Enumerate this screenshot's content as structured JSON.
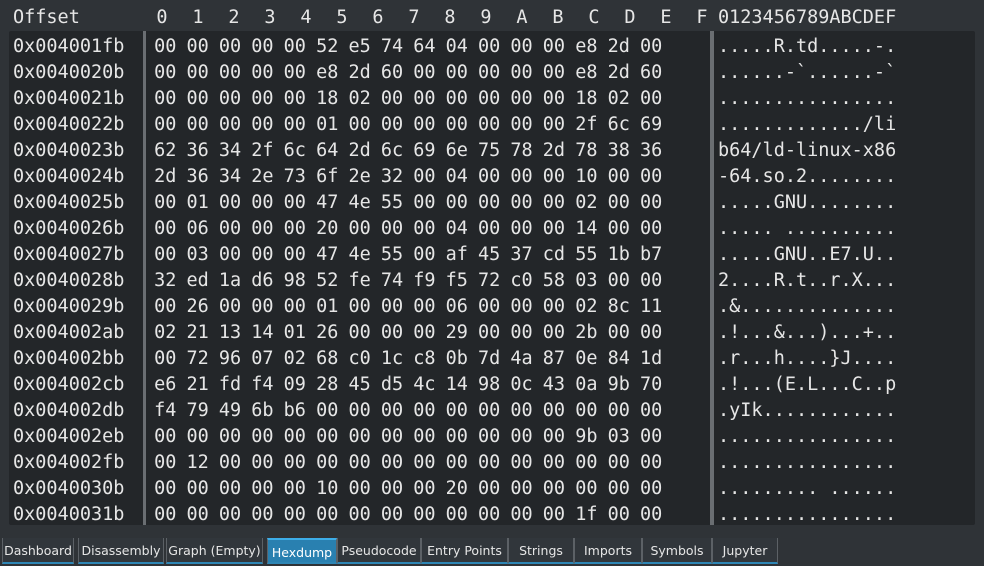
{
  "header": {
    "offset_label": "Offset",
    "columns": [
      "0",
      "1",
      "2",
      "3",
      "4",
      "5",
      "6",
      "7",
      "8",
      "9",
      "A",
      "B",
      "C",
      "D",
      "E",
      "F"
    ],
    "ascii_label": "0123456789ABCDEF"
  },
  "rows": [
    {
      "offset": "0x004001fb",
      "bytes": [
        "00",
        "00",
        "00",
        "00",
        "00",
        "52",
        "e5",
        "74",
        "64",
        "04",
        "00",
        "00",
        "00",
        "e8",
        "2d",
        "00"
      ],
      "ascii": ".....R.td.....-."
    },
    {
      "offset": "0x0040020b",
      "bytes": [
        "00",
        "00",
        "00",
        "00",
        "00",
        "e8",
        "2d",
        "60",
        "00",
        "00",
        "00",
        "00",
        "00",
        "e8",
        "2d",
        "60"
      ],
      "ascii": "......-`......-`"
    },
    {
      "offset": "0x0040021b",
      "bytes": [
        "00",
        "00",
        "00",
        "00",
        "00",
        "18",
        "02",
        "00",
        "00",
        "00",
        "00",
        "00",
        "00",
        "18",
        "02",
        "00"
      ],
      "ascii": "................"
    },
    {
      "offset": "0x0040022b",
      "bytes": [
        "00",
        "00",
        "00",
        "00",
        "00",
        "01",
        "00",
        "00",
        "00",
        "00",
        "00",
        "00",
        "00",
        "2f",
        "6c",
        "69"
      ],
      "ascii": "............./li"
    },
    {
      "offset": "0x0040023b",
      "bytes": [
        "62",
        "36",
        "34",
        "2f",
        "6c",
        "64",
        "2d",
        "6c",
        "69",
        "6e",
        "75",
        "78",
        "2d",
        "78",
        "38",
        "36"
      ],
      "ascii": "b64/ld-linux-x86"
    },
    {
      "offset": "0x0040024b",
      "bytes": [
        "2d",
        "36",
        "34",
        "2e",
        "73",
        "6f",
        "2e",
        "32",
        "00",
        "04",
        "00",
        "00",
        "00",
        "10",
        "00",
        "00"
      ],
      "ascii": "-64.so.2........"
    },
    {
      "offset": "0x0040025b",
      "bytes": [
        "00",
        "01",
        "00",
        "00",
        "00",
        "47",
        "4e",
        "55",
        "00",
        "00",
        "00",
        "00",
        "00",
        "02",
        "00",
        "00"
      ],
      "ascii": ".....GNU........"
    },
    {
      "offset": "0x0040026b",
      "bytes": [
        "00",
        "06",
        "00",
        "00",
        "00",
        "20",
        "00",
        "00",
        "00",
        "04",
        "00",
        "00",
        "00",
        "14",
        "00",
        "00"
      ],
      "ascii": "..... .........."
    },
    {
      "offset": "0x0040027b",
      "bytes": [
        "00",
        "03",
        "00",
        "00",
        "00",
        "47",
        "4e",
        "55",
        "00",
        "af",
        "45",
        "37",
        "cd",
        "55",
        "1b",
        "b7"
      ],
      "ascii": ".....GNU..E7.U.."
    },
    {
      "offset": "0x0040028b",
      "bytes": [
        "32",
        "ed",
        "1a",
        "d6",
        "98",
        "52",
        "fe",
        "74",
        "f9",
        "f5",
        "72",
        "c0",
        "58",
        "03",
        "00",
        "00"
      ],
      "ascii": "2....R.t..r.X..."
    },
    {
      "offset": "0x0040029b",
      "bytes": [
        "00",
        "26",
        "00",
        "00",
        "00",
        "01",
        "00",
        "00",
        "00",
        "06",
        "00",
        "00",
        "00",
        "02",
        "8c",
        "11"
      ],
      "ascii": ".&.............."
    },
    {
      "offset": "0x004002ab",
      "bytes": [
        "02",
        "21",
        "13",
        "14",
        "01",
        "26",
        "00",
        "00",
        "00",
        "29",
        "00",
        "00",
        "00",
        "2b",
        "00",
        "00"
      ],
      "ascii": ".!...&...)...+.."
    },
    {
      "offset": "0x004002bb",
      "bytes": [
        "00",
        "72",
        "96",
        "07",
        "02",
        "68",
        "c0",
        "1c",
        "c8",
        "0b",
        "7d",
        "4a",
        "87",
        "0e",
        "84",
        "1d"
      ],
      "ascii": ".r...h....}J...."
    },
    {
      "offset": "0x004002cb",
      "bytes": [
        "e6",
        "21",
        "fd",
        "f4",
        "09",
        "28",
        "45",
        "d5",
        "4c",
        "14",
        "98",
        "0c",
        "43",
        "0a",
        "9b",
        "70"
      ],
      "ascii": ".!...(E.L...C..p"
    },
    {
      "offset": "0x004002db",
      "bytes": [
        "f4",
        "79",
        "49",
        "6b",
        "b6",
        "00",
        "00",
        "00",
        "00",
        "00",
        "00",
        "00",
        "00",
        "00",
        "00",
        "00"
      ],
      "ascii": ".yIk............"
    },
    {
      "offset": "0x004002eb",
      "bytes": [
        "00",
        "00",
        "00",
        "00",
        "00",
        "00",
        "00",
        "00",
        "00",
        "00",
        "00",
        "00",
        "00",
        "9b",
        "03",
        "00"
      ],
      "ascii": "................"
    },
    {
      "offset": "0x004002fb",
      "bytes": [
        "00",
        "12",
        "00",
        "00",
        "00",
        "00",
        "00",
        "00",
        "00",
        "00",
        "00",
        "00",
        "00",
        "00",
        "00",
        "00"
      ],
      "ascii": "................"
    },
    {
      "offset": "0x0040030b",
      "bytes": [
        "00",
        "00",
        "00",
        "00",
        "00",
        "10",
        "00",
        "00",
        "00",
        "20",
        "00",
        "00",
        "00",
        "00",
        "00",
        "00"
      ],
      "ascii": "......... ......"
    },
    {
      "offset": "0x0040031b",
      "bytes": [
        "00",
        "00",
        "00",
        "00",
        "00",
        "00",
        "00",
        "00",
        "00",
        "00",
        "00",
        "00",
        "00",
        "1f",
        "00",
        "00"
      ],
      "ascii": "................"
    }
  ],
  "tabs": [
    {
      "label": "Dashboard",
      "active": false
    },
    {
      "label": "Disassembly",
      "active": false
    },
    {
      "label": "Graph (Empty)",
      "active": false
    },
    {
      "label": "Hexdump",
      "active": true
    },
    {
      "label": "Pseudocode",
      "active": false
    },
    {
      "label": "Entry Points",
      "active": false
    },
    {
      "label": "Strings",
      "active": false
    },
    {
      "label": "Imports",
      "active": false
    },
    {
      "label": "Symbols",
      "active": false
    },
    {
      "label": "Jupyter",
      "active": false
    }
  ],
  "colors": {
    "active_tab": "#2980b0",
    "panel_bg": "#232629",
    "window_bg": "#2f3337"
  }
}
